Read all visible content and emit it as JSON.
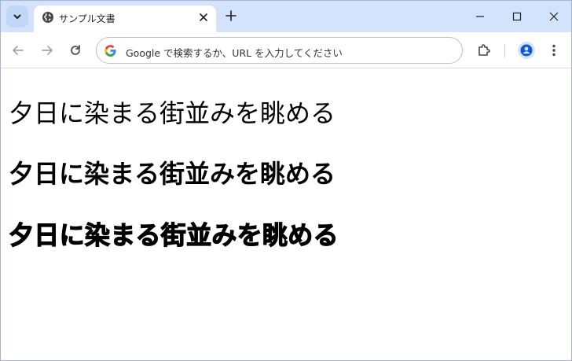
{
  "tabs": [
    {
      "title": "サンプル文書",
      "favicon": "globe-icon",
      "active": true
    }
  ],
  "window_controls": [
    "minimize-icon",
    "maximize-icon",
    "close-icon"
  ],
  "toolbar": {
    "omnibox_placeholder": "Google で検索するか、URL を入力してください"
  },
  "content": {
    "lines": [
      {
        "text": "夕日に染まる街並みを眺める",
        "weight": "normal"
      },
      {
        "text": "夕日に染まる街並みを眺める",
        "weight": "bold"
      },
      {
        "text": "夕日に染まる街並みを眺める",
        "weight": "heavy"
      }
    ]
  },
  "colors": {
    "tabstrip": "#d3e3fd",
    "tab_active": "#ffffff",
    "text": "#000000",
    "profile": "#0b57d0"
  }
}
